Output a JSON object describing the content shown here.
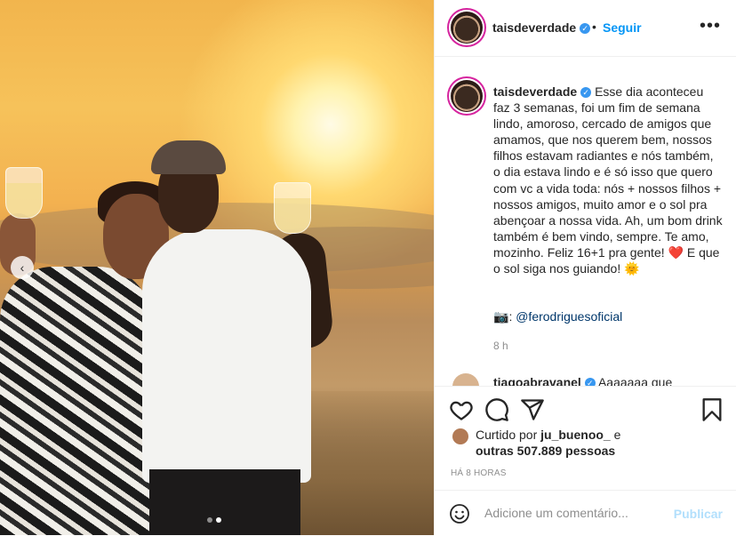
{
  "post": {
    "username": "taisdeverdade",
    "separator": "•",
    "follow_label": "Seguir",
    "more_icon": "more-options-icon",
    "more_glyph": "•••"
  },
  "caption": {
    "username": "taisdeverdade",
    "text": "Esse dia aconteceu faz 3 semanas, foi um fim de semana lindo, amoroso, cercado de amigos que amamos, que nos querem bem, nossos filhos estavam radiantes e nós também, o dia estava lindo e é só isso que quero com vc a vida toda: nós + nossos filhos + nossos amigos, muito amor e o sol pra abençoar a nossa vida. Ah, um bom drink também é bem vindo, sempre. Te amo, mozinho. Feliz 16+1 pra gente!",
    "heart_emoji": "❤️",
    "text_after_heart": "E que o sol siga nos guiando!",
    "sun_emoji": "🌞",
    "camera_emoji": "📷",
    "credit_separator": ":",
    "credit_handle": "@ferodriguesoficial",
    "time": "8 h"
  },
  "reply": {
    "username": "tiagoabravanel",
    "text": "Aaaaaaa que"
  },
  "likes": {
    "prefix": "Curtido por",
    "user": "ju_buenoo_",
    "middle": "e",
    "others": "outras 507.889 pessoas"
  },
  "timestamp": "HÁ 8 HORAS",
  "comment_box": {
    "placeholder": "Adicione um comentário...",
    "publish_label": "Publicar"
  },
  "carousel": {
    "prev_icon": "chevron-left-icon",
    "prev_glyph": "‹",
    "slides": 2,
    "active_index": 1
  },
  "colors": {
    "follow": "#0095f6",
    "publish_disabled": "#b2dffc",
    "link": "#00376b",
    "heart": "#ed4956",
    "story_ring": "#d6249f"
  }
}
